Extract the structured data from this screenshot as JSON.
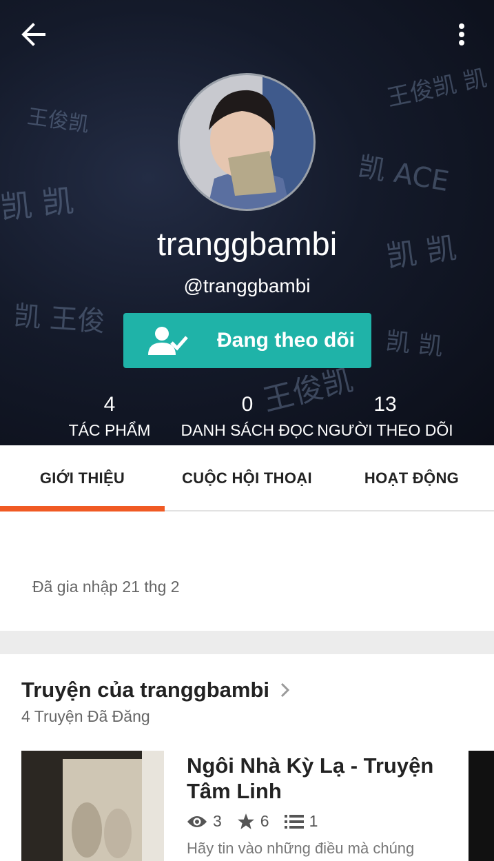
{
  "header": {
    "username": "tranggbambi",
    "handle": "@tranggbambi",
    "follow_button_label": "Đang theo dõi",
    "back_icon": "arrow-left-icon",
    "more_icon": "more-vertical-icon",
    "stats": [
      {
        "value": "4",
        "label": "TÁC PHẨM"
      },
      {
        "value": "0",
        "label": "DANH SÁCH ĐỌC"
      },
      {
        "value": "13",
        "label": "NGƯỜI THEO DÕI"
      }
    ]
  },
  "tabs": [
    {
      "label": "GIỚI THIỆU",
      "active": true
    },
    {
      "label": "CUỘC HỘI THOẠI",
      "active": false
    },
    {
      "label": "HOẠT ĐỘNG",
      "active": false
    }
  ],
  "about": {
    "joined": "Đã gia nhập 21 thg 2"
  },
  "stories": {
    "title": "Truyện của tranggbambi",
    "count_text": "4 Truyện Đã Đăng",
    "items": [
      {
        "title": "Ngôi Nhà Kỳ Lạ - Truyện Tâm Linh",
        "views": "3",
        "votes": "6",
        "parts": "1",
        "description": "Hãy tin vào những điều mà chúng"
      }
    ]
  },
  "colors": {
    "accent": "#f05a24",
    "follow_button": "#1fb3a8"
  }
}
